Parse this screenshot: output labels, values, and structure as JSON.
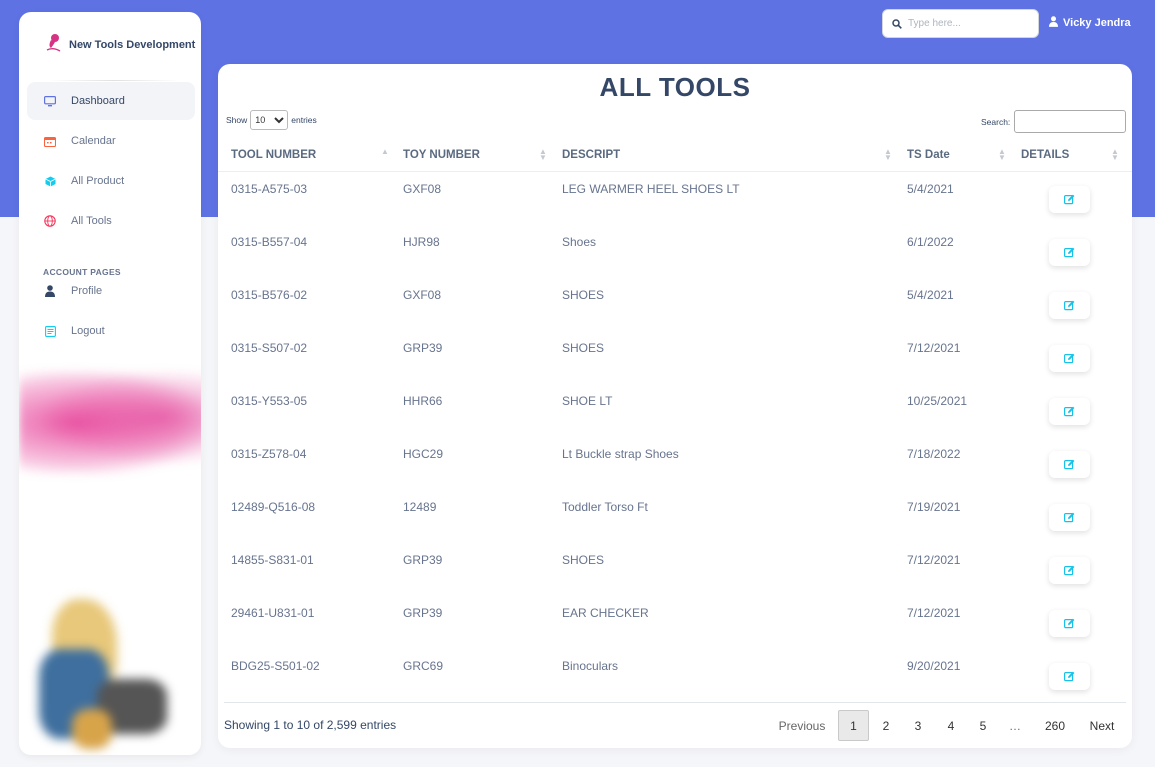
{
  "sidebar": {
    "brand": "New Tools Development",
    "items": [
      {
        "label": "Dashboard",
        "icon": "monitor-icon"
      },
      {
        "label": "Calendar",
        "icon": "calendar-icon"
      },
      {
        "label": "All Product",
        "icon": "cube-icon"
      },
      {
        "label": "All Tools",
        "icon": "globe-icon"
      }
    ],
    "section_label": "ACCOUNT PAGES",
    "account_items": [
      {
        "label": "Profile",
        "icon": "user-icon"
      },
      {
        "label": "Logout",
        "icon": "document-icon"
      }
    ]
  },
  "header": {
    "search_placeholder": "Type here...",
    "user_name": "Vicky Jendra"
  },
  "main": {
    "title": "ALL TOOLS",
    "show_label": "Show",
    "entries_label": "entries",
    "entries_value": "10",
    "search_label": "Search:",
    "columns": [
      "TOOL NUMBER",
      "TOY NUMBER",
      "DESCRIPT",
      "TS Date",
      "DETAILS"
    ],
    "rows": [
      {
        "tool": "0315-A575-03",
        "toy": "GXF08",
        "desc": "LEG WARMER HEEL SHOES LT",
        "date": "5/4/2021"
      },
      {
        "tool": "0315-B557-04",
        "toy": "HJR98",
        "desc": "Shoes",
        "date": "6/1/2022"
      },
      {
        "tool": "0315-B576-02",
        "toy": "GXF08",
        "desc": "SHOES",
        "date": "5/4/2021"
      },
      {
        "tool": "0315-S507-02",
        "toy": "GRP39",
        "desc": "SHOES",
        "date": "7/12/2021"
      },
      {
        "tool": "0315-Y553-05",
        "toy": "HHR66",
        "desc": "SHOE LT",
        "date": "10/25/2021"
      },
      {
        "tool": "0315-Z578-04",
        "toy": "HGC29",
        "desc": "Lt Buckle strap Shoes",
        "date": "7/18/2022"
      },
      {
        "tool": "12489-Q516-08",
        "toy": "12489",
        "desc": "Toddler Torso Ft",
        "date": "7/19/2021"
      },
      {
        "tool": "14855-S831-01",
        "toy": "GRP39",
        "desc": "SHOES",
        "date": "7/12/2021"
      },
      {
        "tool": "29461-U831-01",
        "toy": "GRP39",
        "desc": "EAR CHECKER",
        "date": "7/12/2021"
      },
      {
        "tool": "BDG25-S501-02",
        "toy": "GRC69",
        "desc": "Binoculars",
        "date": "9/20/2021"
      }
    ],
    "info": "Showing 1 to 10 of 2,599 entries",
    "pagination": {
      "previous": "Previous",
      "pages": [
        "1",
        "2",
        "3",
        "4",
        "5",
        "…",
        "260"
      ],
      "next": "Next",
      "current": "1"
    }
  },
  "colors": {
    "accent": "#5e72e4",
    "edit_icon": "#17c1e8",
    "text_dark": "#344767",
    "text_muted": "#67748e"
  }
}
